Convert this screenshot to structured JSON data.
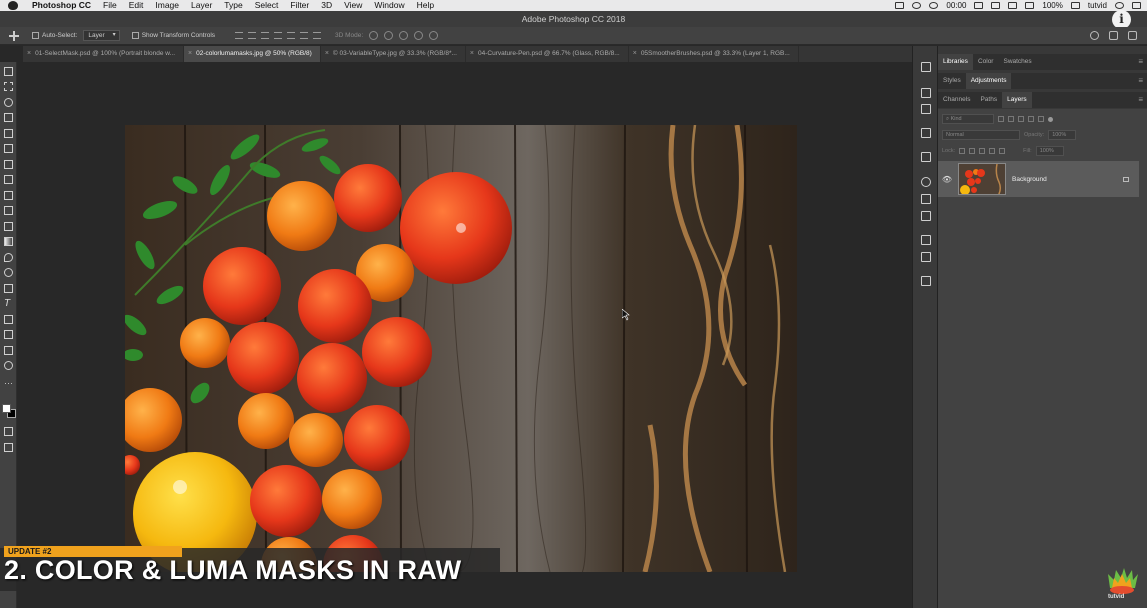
{
  "menubar": {
    "app_name": "Photoshop CC",
    "items": [
      "File",
      "Edit",
      "Image",
      "Layer",
      "Type",
      "Select",
      "Filter",
      "3D",
      "View",
      "Window",
      "Help"
    ],
    "clock": "00:00",
    "battery": "100%",
    "user": "tutvid"
  },
  "window": {
    "title": "Adobe Photoshop CC 2018"
  },
  "options": {
    "auto_select_label": "Auto-Select:",
    "auto_select_value": "Layer",
    "transform_controls_label": "Show Transform Controls",
    "mode_3d_label": "3D Mode:"
  },
  "tabs": [
    {
      "label": "01-SelectMask.psd @ 100% (Portrait  blonde w..."
    },
    {
      "label": "02-colorlumamasks.jpg @ 50% (RGB/8)"
    },
    {
      "label": "© 03-VariableType.jpg @ 33.3% (RGB/8*..."
    },
    {
      "label": "04-Curvature-Pen.psd @ 66.7% (Glass, RGB/8..."
    },
    {
      "label": "05SmootherBrushes.psd @ 33.3% (Layer 1, RGB..."
    }
  ],
  "panels": {
    "top_tabs": [
      "Libraries",
      "Color",
      "Swatches"
    ],
    "mid_tabs": [
      "Styles",
      "Adjustments"
    ],
    "layer_tabs": [
      "Channels",
      "Paths",
      "Layers"
    ],
    "kind_label": "Kind",
    "blend_mode": "Normal",
    "opacity_label": "Opacity:",
    "opacity_value": "100%",
    "lock_label": "Lock:",
    "fill_label": "Fill:",
    "fill_value": "100%",
    "layer_name": "Background"
  },
  "overlay": {
    "badge": "UPDATE #2",
    "headline": "2. COLOR & LUMA MASKS IN RAW"
  },
  "watermark": {
    "label": "tutvid"
  },
  "colors": {
    "accent_orange": "#f0a21d",
    "ui_dark": "#282828",
    "panel": "#424242"
  }
}
